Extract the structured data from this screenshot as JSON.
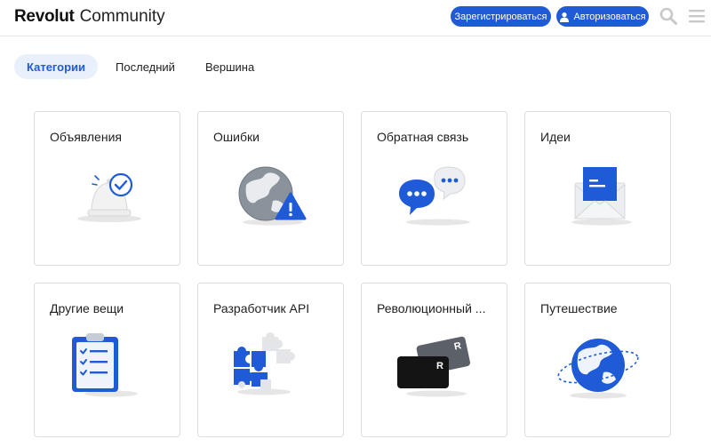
{
  "header": {
    "brand": "Revolut",
    "community": "Community",
    "register_label": "Зарегистрироваться",
    "login_label": "Авторизоваться"
  },
  "nav": {
    "tabs": [
      {
        "label": "Категории",
        "active": true
      },
      {
        "label": "Последний",
        "active": false
      },
      {
        "label": "Вершина",
        "active": false
      }
    ]
  },
  "categories": [
    {
      "title": "Объявления",
      "icon": "bell-check-icon"
    },
    {
      "title": "Ошибки",
      "icon": "globe-warning-icon"
    },
    {
      "title": "Обратная связь",
      "icon": "chat-bubbles-icon"
    },
    {
      "title": "Идеи",
      "icon": "envelope-icon"
    },
    {
      "title": "Другие вещи",
      "icon": "clipboard-checklist-icon"
    },
    {
      "title": "Разработчик API",
      "icon": "puzzle-pieces-icon"
    },
    {
      "title": "Революционный ...",
      "icon": "cards-icon"
    },
    {
      "title": "Путешествие",
      "icon": "globe-orbit-icon"
    }
  ],
  "colors": {
    "accent": "#1f5bd6",
    "active_tab_bg": "#e8f0fb",
    "warning": "#1f5bd6"
  }
}
